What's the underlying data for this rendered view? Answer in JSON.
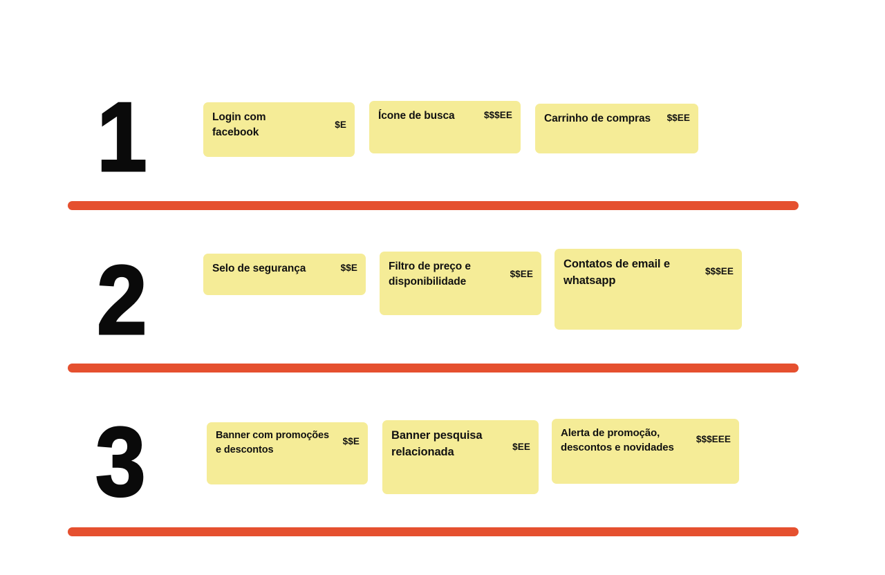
{
  "theme": {
    "background": "#ffffff",
    "card_fill": "#f5ec97",
    "divider_color": "#e5502f",
    "text_color": "#111111",
    "numeral_color": "#0a0a0a"
  },
  "rows": [
    {
      "number": "1",
      "cards": [
        {
          "label": "Login com\nfacebook",
          "price": "$E"
        },
        {
          "label": "Ícone de busca",
          "price": "$$$EE"
        },
        {
          "label": "Carrinho de compras",
          "price": "$$EE"
        }
      ]
    },
    {
      "number": "2",
      "cards": [
        {
          "label": "Selo de segurança",
          "price": "$$E"
        },
        {
          "label": "Filtro de preço e\ndisponibilidade",
          "price": "$$EE"
        },
        {
          "label": "Contatos de email e\nwhatsapp",
          "price": "$$$EE"
        }
      ]
    },
    {
      "number": "3",
      "cards": [
        {
          "label": "Banner com promoções\ne descontos",
          "price": "$$E"
        },
        {
          "label": "Banner pesquisa\nrelacionada",
          "price": "$EE"
        },
        {
          "label": "Alerta de promoção,\ndescontos e novidades",
          "price": "$$$EEE"
        }
      ]
    }
  ],
  "dividers": [
    {
      "name": "divider-after-row-1"
    },
    {
      "name": "divider-after-row-2"
    },
    {
      "name": "divider-after-row-3"
    }
  ]
}
